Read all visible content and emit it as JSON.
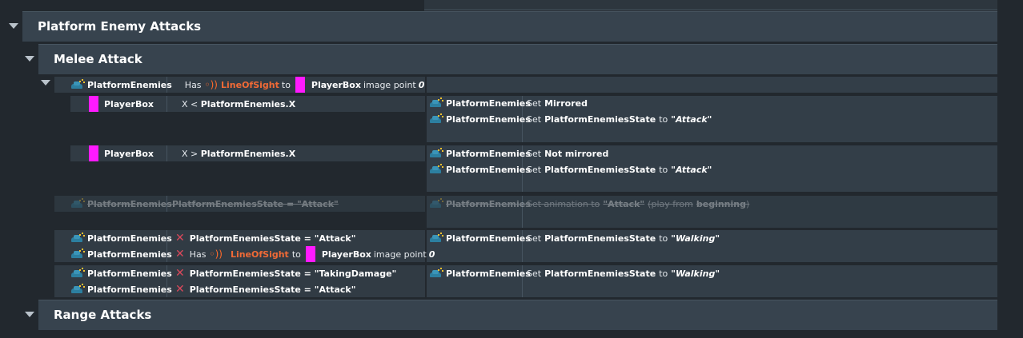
{
  "groups": {
    "platform": {
      "title": "Platform Enemy Attacks"
    },
    "melee": {
      "title": "Melee Attack"
    },
    "range": {
      "title": "Range Attacks"
    }
  },
  "labels": {
    "obj_enemies": "PlatformEnemies",
    "obj_player": "PlayerBox",
    "has": "Has",
    "line_of_sight": "LineOfSight",
    "to": "to",
    "image_point": "image point",
    "zero": "0",
    "x_lt": "X < ",
    "x_gt": "X > ",
    "enemies_x": "PlatformEnemies.X",
    "set": "Set",
    "mirrored": "Mirrored",
    "not_mirrored": "Not mirrored",
    "state_var": "PlatformEnemiesState",
    "attack_str": "\"Attack\"",
    "walking_str": "\"Walking\"",
    "cond_state_attack": "PlatformEnemiesState = \"Attack\"",
    "cond_state_taking": "PlatformEnemiesState = \"TakingDamage\"",
    "set_animation": "Set animation to",
    "play_from": "(play from",
    "beginning": "beginning",
    "close_paren": ")"
  },
  "icons": {
    "enemy": "platform-enemies-icon",
    "player": "playerbox-icon",
    "los": "line-of-sight-icon",
    "invert": "invert-x-icon",
    "collapse": "collapse-triangle-icon"
  },
  "colors": {
    "background": "#22282e",
    "group_bar": "#37434e",
    "accent_orange": "#f06a36",
    "player_magenta": "#ff1aff",
    "invert_red": "#d9485b"
  }
}
